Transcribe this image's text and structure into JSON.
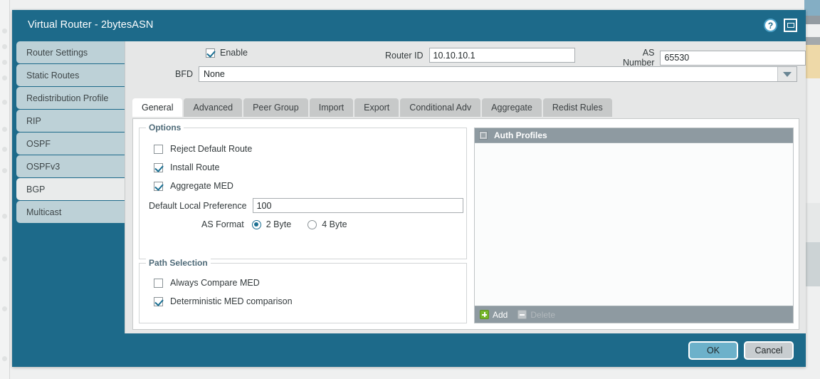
{
  "window": {
    "title": "Virtual Router - 2bytesASN",
    "help_icon": "help-circle-icon",
    "minimize_icon": "restore-window-icon",
    "accent_color": "#1d6a8a"
  },
  "sidebar": {
    "items": [
      {
        "label": "Router Settings",
        "selected": false
      },
      {
        "label": "Static Routes",
        "selected": false
      },
      {
        "label": "Redistribution Profile",
        "selected": false
      },
      {
        "label": "RIP",
        "selected": false
      },
      {
        "label": "OSPF",
        "selected": false
      },
      {
        "label": "OSPFv3",
        "selected": false
      },
      {
        "label": "BGP",
        "selected": true
      },
      {
        "label": "Multicast",
        "selected": false
      }
    ]
  },
  "form": {
    "enable_label": "Enable",
    "enable_checked": true,
    "router_id_label": "Router ID",
    "router_id_value": "10.10.10.1",
    "as_number_label": "AS Number",
    "as_number_value": "65530",
    "bfd_label": "BFD",
    "bfd_value": "None"
  },
  "tabs": [
    {
      "label": "General",
      "active": true
    },
    {
      "label": "Advanced",
      "active": false
    },
    {
      "label": "Peer Group",
      "active": false
    },
    {
      "label": "Import",
      "active": false
    },
    {
      "label": "Export",
      "active": false
    },
    {
      "label": "Conditional Adv",
      "active": false
    },
    {
      "label": "Aggregate",
      "active": false
    },
    {
      "label": "Redist Rules",
      "active": false
    }
  ],
  "options": {
    "title": "Options",
    "reject_default_route_label": "Reject Default Route",
    "reject_default_route_checked": false,
    "install_route_label": "Install Route",
    "install_route_checked": true,
    "aggregate_med_label": "Aggregate MED",
    "aggregate_med_checked": true,
    "default_local_pref_label": "Default Local Preference",
    "default_local_pref_value": "100",
    "as_format_label": "AS Format",
    "as_format_option_1": "2 Byte",
    "as_format_option_2": "4 Byte",
    "as_format_selected": "2 Byte"
  },
  "path_selection": {
    "title": "Path Selection",
    "always_compare_med_label": "Always Compare MED",
    "always_compare_med_checked": false,
    "deterministic_med_label": "Deterministic MED comparison",
    "deterministic_med_checked": true
  },
  "auth_profiles": {
    "header_label": "Auth Profiles",
    "rows": [],
    "add_label": "Add",
    "delete_label": "Delete",
    "add_icon": "plus-icon",
    "delete_icon": "minus-icon",
    "delete_enabled": false
  },
  "footer": {
    "ok_label": "OK",
    "cancel_label": "Cancel"
  }
}
